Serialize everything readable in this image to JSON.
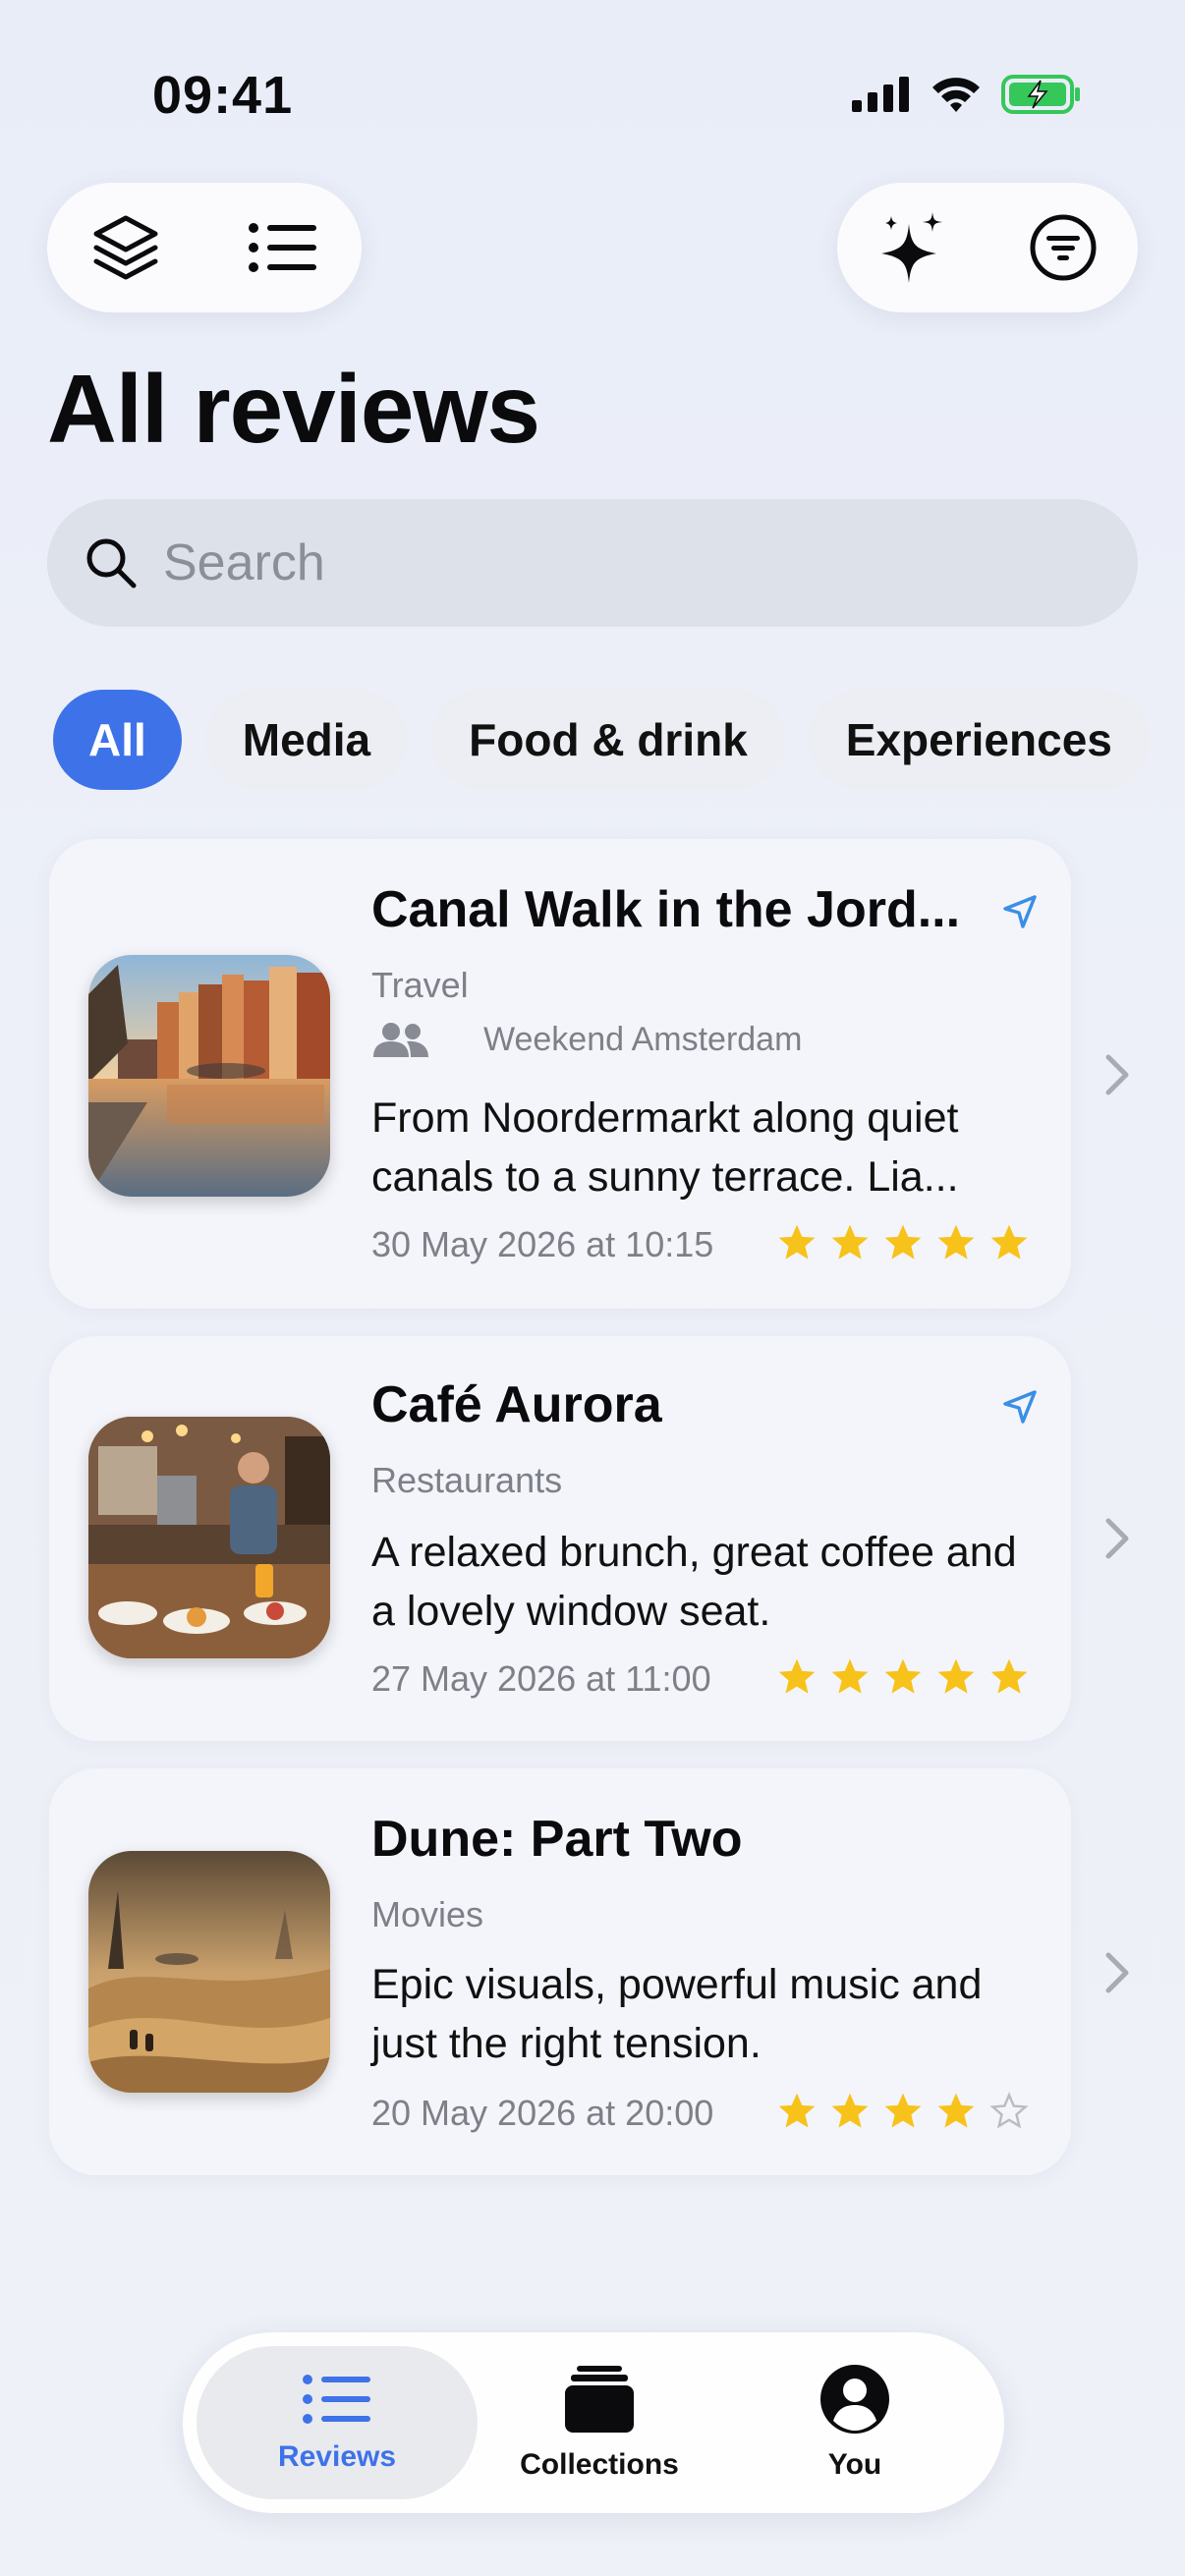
{
  "status_bar": {
    "time": "09:41"
  },
  "page": {
    "title": "All reviews"
  },
  "search": {
    "placeholder": "Search"
  },
  "filters": [
    "All",
    "Media",
    "Food & drink",
    "Experiences"
  ],
  "colors": {
    "accent": "#3e72e8",
    "star": "#f7c21a",
    "location": "#3a8ee6"
  },
  "reviews": [
    {
      "title": "Canal Walk in the Jord...",
      "category": "Travel",
      "group": "Weekend Amsterdam",
      "description": "From Noordermarkt along quiet canals to a sunny terrace. Lia...",
      "date": "30 May 2026 at 10:15",
      "rating": 5
    },
    {
      "title": "Café Aurora",
      "category": "Restaurants",
      "description": "A relaxed brunch, great coffee and a lovely window seat.",
      "date": "27 May 2026 at 11:00",
      "rating": 5
    },
    {
      "title": "Dune: Part Two",
      "category": "Movies",
      "description": "Epic visuals, powerful music and just the right tension.",
      "date": "20 May 2026 at 20:00",
      "rating": 4
    }
  ],
  "tabbar": {
    "tabs": [
      "Reviews",
      "Collections",
      "You"
    ]
  }
}
